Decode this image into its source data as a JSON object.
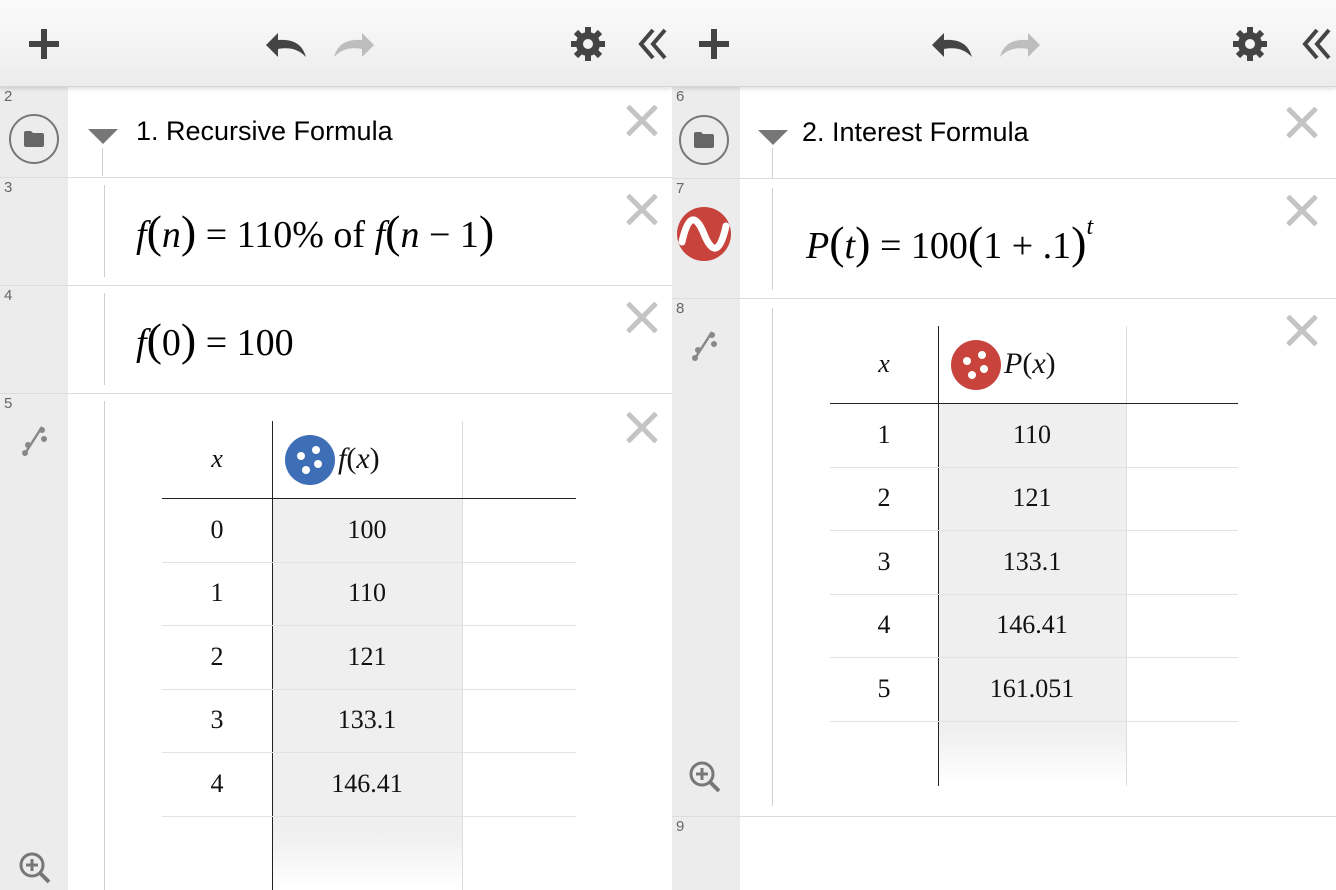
{
  "left": {
    "folder": {
      "index": "2",
      "label": "1. Recursive Formula"
    },
    "expr1": {
      "index": "3",
      "lhs_f": "f",
      "lhs_arg": "n",
      "eq": "=",
      "rhs_text": "110% of",
      "rhs_f": "f",
      "rhs_arg_var": "n",
      "rhs_arg_rest": "− 1"
    },
    "expr2": {
      "index": "4",
      "f": "f",
      "arg": "0",
      "rhs": "= 100"
    },
    "table": {
      "index": "5",
      "col_x": "x",
      "col_y_f": "f",
      "col_y_arg": "x",
      "icon_color": "#3e6eb6",
      "rows": [
        {
          "x": "0",
          "y": "100"
        },
        {
          "x": "1",
          "y": "110"
        },
        {
          "x": "2",
          "y": "121"
        },
        {
          "x": "3",
          "y": "133.1"
        },
        {
          "x": "4",
          "y": "146.41"
        }
      ]
    }
  },
  "right": {
    "folder": {
      "index": "6",
      "label": "2. Interest Formula"
    },
    "expr1": {
      "index": "7",
      "lhs_f": "P",
      "lhs_arg": "t",
      "rhs_a": "= 100",
      "rhs_b": "1 + .1",
      "exp": "t",
      "icon_color": "#c7433c"
    },
    "table": {
      "index": "8",
      "col_x": "x",
      "col_y_f": "P",
      "col_y_arg": "x",
      "icon_color": "#c7433c",
      "rows": [
        {
          "x": "1",
          "y": "110"
        },
        {
          "x": "2",
          "y": "121"
        },
        {
          "x": "3",
          "y": "133.1"
        },
        {
          "x": "4",
          "y": "146.41"
        },
        {
          "x": "5",
          "y": "161.051"
        }
      ]
    },
    "next_index": "9"
  },
  "icons": [
    "add-icon",
    "undo-icon",
    "redo-icon",
    "gear-icon",
    "collapse-icon",
    "folder-icon",
    "table-icon",
    "zoom-in-icon",
    "wave-icon",
    "points-icon"
  ]
}
